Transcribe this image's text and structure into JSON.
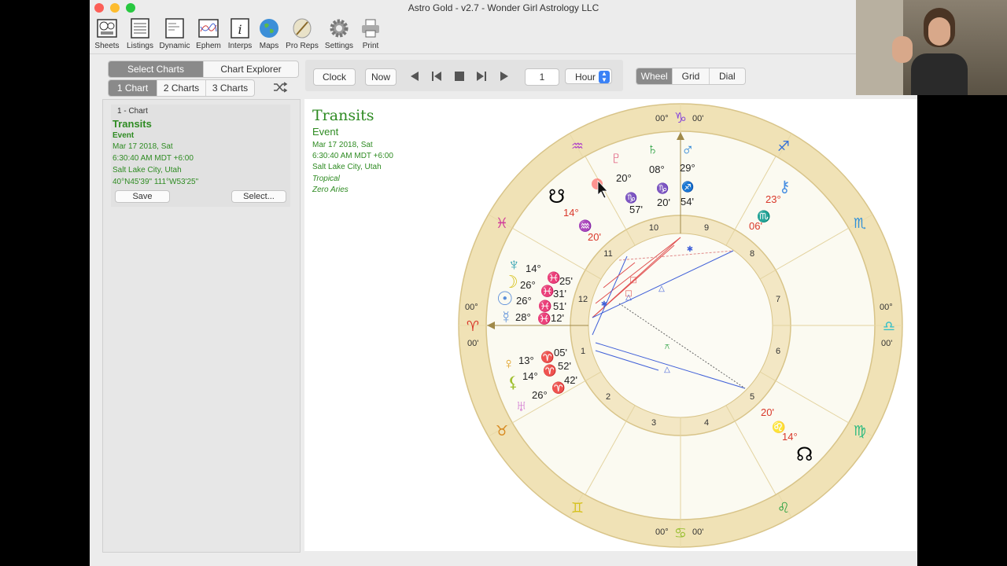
{
  "window": {
    "title": "Astro Gold - v2.7 - Wonder Girl Astrology LLC"
  },
  "toolbar": [
    "Sheets",
    "Listings",
    "Dynamic",
    "Ephem",
    "Interps",
    "Maps",
    "Pro Reps",
    "Settings",
    "Print"
  ],
  "tabs": {
    "select_charts": "Select Charts",
    "chart_explorer": "Chart Explorer"
  },
  "chart_count": {
    "one": "1 Chart",
    "two": "2 Charts",
    "three": "3 Charts"
  },
  "controls": {
    "clock": "Clock",
    "now": "Now",
    "step_value": "1",
    "unit": "Hour"
  },
  "view": {
    "wheel": "Wheel",
    "grid": "Grid",
    "dial": "Dial"
  },
  "chart_card": {
    "label": "1 - Chart",
    "title": "Transits",
    "type": "Event",
    "date": "Mar 17 2018, Sat",
    "time": "6:30:40 AM MDT +6:00",
    "place": "Salt Lake City, Utah",
    "coords": "40°N45'39\" 111°W53'25\"",
    "save": "Save",
    "select": "Select..."
  },
  "chart_info": {
    "title": "Transits",
    "type": "Event",
    "date": "Mar 17 2018, Sat",
    "time": "6:30:40 AM MDT +6:00",
    "place": "Salt Lake City, Utah",
    "zodiac": "Tropical",
    "ayanamsa": "Zero Aries"
  },
  "wheel": {
    "sign_degree_labels": [
      "00°",
      "00'"
    ],
    "house_numbers": [
      "1",
      "2",
      "3",
      "4",
      "5",
      "6",
      "7",
      "8",
      "9",
      "10",
      "11",
      "12"
    ],
    "planets": [
      {
        "glyph": "☊",
        "deg": "14°",
        "sign": "♌",
        "min": "20'",
        "color": "#000000"
      },
      {
        "glyph": "☋",
        "deg": "14°",
        "sign": "♒",
        "min": "20'",
        "color": "#000000"
      },
      {
        "glyph": "♇",
        "deg": "20°",
        "sign": "♑",
        "min": "57'",
        "color": "#e05a7a"
      },
      {
        "glyph": "♄",
        "deg": "08°",
        "sign": "♑",
        "min": "20'",
        "color": "#2aa040"
      },
      {
        "glyph": "♂",
        "deg": "29°",
        "sign": "♐",
        "min": "54'",
        "color": "#2f86d6"
      },
      {
        "glyph": "♆",
        "deg": "14°",
        "sign": "♓",
        "min": "25'",
        "color": "#2a9fb0"
      },
      {
        "glyph": "☽",
        "deg": "26°",
        "sign": "♓",
        "min": "31'",
        "color": "#d6c21e"
      },
      {
        "glyph": "☉",
        "deg": "26°",
        "sign": "♓",
        "min": "51'",
        "color": "#5b8fd9"
      },
      {
        "glyph": "☿",
        "deg": "28°",
        "sign": "♓",
        "min": "12'",
        "color": "#5b8fd9"
      },
      {
        "glyph": "♀",
        "deg": "13°",
        "sign": "♈",
        "min": "05'",
        "color": "#e0a020"
      },
      {
        "glyph": "♅",
        "deg": "26°",
        "sign": "♈",
        "min": "42'",
        "color": "#d070d0"
      },
      {
        "glyph": "⚷",
        "deg": "23°",
        "sign": "♏",
        "min": "06'",
        "color": "#4a90e2"
      }
    ],
    "extra_points": [
      {
        "glyph": "⚸",
        "deg": "14°",
        "sign": "♈",
        "min": "52'",
        "color": "#a0c030"
      }
    ]
  }
}
